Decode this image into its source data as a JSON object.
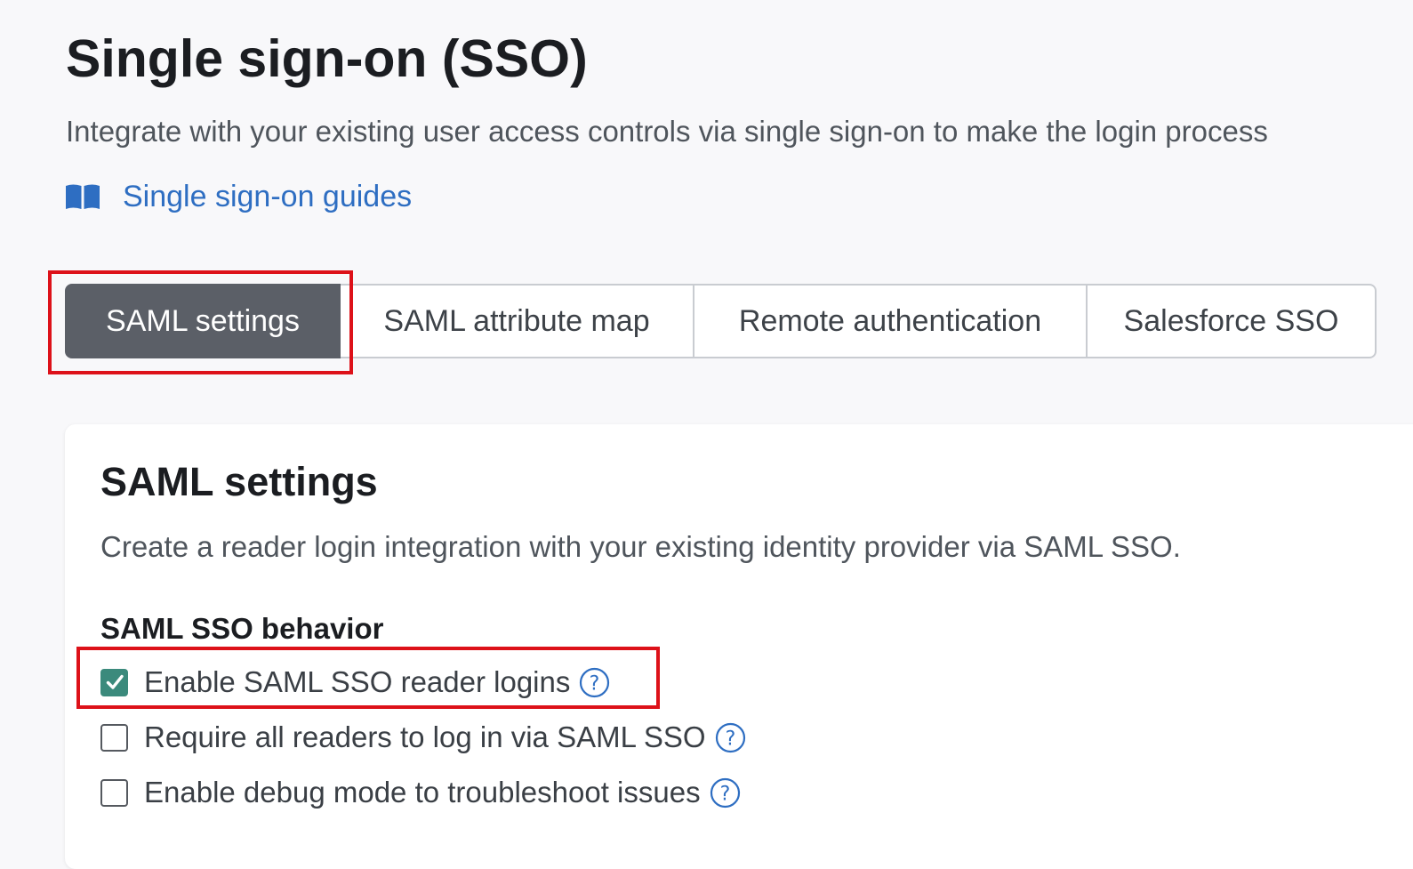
{
  "page": {
    "title": "Single sign-on (SSO)",
    "description": "Integrate with your existing user access controls via single sign-on to make the login process",
    "guides_link": "Single sign-on guides"
  },
  "tabs": [
    {
      "label": "SAML settings",
      "active": true
    },
    {
      "label": "SAML attribute map",
      "active": false
    },
    {
      "label": "Remote authentication",
      "active": false
    },
    {
      "label": "Salesforce SSO",
      "active": false
    }
  ],
  "card": {
    "title": "SAML settings",
    "description": "Create a reader login integration with your existing identity provider via SAML SSO.",
    "section_heading": "SAML SSO behavior",
    "options": [
      {
        "label": "Enable SAML SSO reader logins",
        "checked": true
      },
      {
        "label": "Require all readers to log in via SAML SSO",
        "checked": false
      },
      {
        "label": "Enable debug mode to troubleshoot issues",
        "checked": false
      }
    ]
  },
  "colors": {
    "accent_link": "#2e6ec2",
    "active_tab_bg": "#5b5f67",
    "checkbox_checked": "#3b8a7c",
    "highlight": "#dd1119"
  },
  "icons": {
    "guides": "book-icon",
    "help": "help-circle-icon",
    "check": "check-icon"
  }
}
